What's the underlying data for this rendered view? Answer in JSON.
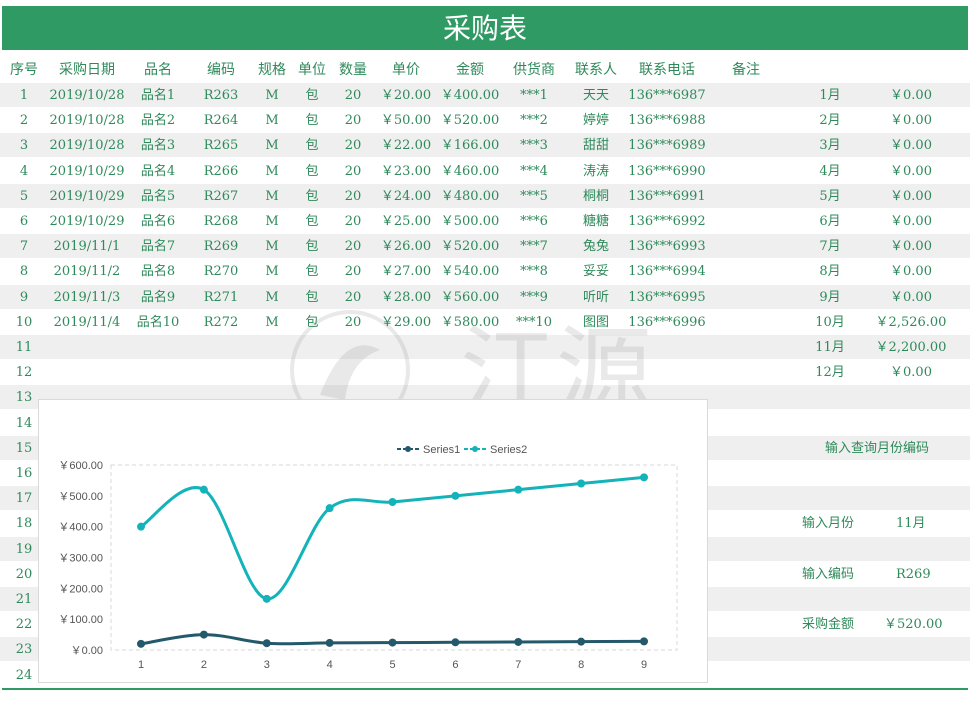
{
  "title": "采购表",
  "headers": [
    "序号",
    "采购日期",
    "品名",
    "编码",
    "规格",
    "单位",
    "数量",
    "单价",
    "金额",
    "供货商",
    "联系人",
    "联系电话",
    "备注"
  ],
  "rows": [
    [
      "1",
      "2019/10/28",
      "品名1",
      "R263",
      "M",
      "包",
      "20",
      "￥20.00",
      "￥400.00",
      "***1",
      "天天",
      "136***6987",
      ""
    ],
    [
      "2",
      "2019/10/28",
      "品名2",
      "R264",
      "M",
      "包",
      "20",
      "￥50.00",
      "￥520.00",
      "***2",
      "婷婷",
      "136***6988",
      ""
    ],
    [
      "3",
      "2019/10/28",
      "品名3",
      "R265",
      "M",
      "包",
      "20",
      "￥22.00",
      "￥166.00",
      "***3",
      "甜甜",
      "136***6989",
      ""
    ],
    [
      "4",
      "2019/10/29",
      "品名4",
      "R266",
      "M",
      "包",
      "20",
      "￥23.00",
      "￥460.00",
      "***4",
      "涛涛",
      "136***6990",
      ""
    ],
    [
      "5",
      "2019/10/29",
      "品名5",
      "R267",
      "M",
      "包",
      "20",
      "￥24.00",
      "￥480.00",
      "***5",
      "桐桐",
      "136***6991",
      ""
    ],
    [
      "6",
      "2019/10/29",
      "品名6",
      "R268",
      "M",
      "包",
      "20",
      "￥25.00",
      "￥500.00",
      "***6",
      "糖糖",
      "136***6992",
      ""
    ],
    [
      "7",
      "2019/11/1",
      "品名7",
      "R269",
      "M",
      "包",
      "20",
      "￥26.00",
      "￥520.00",
      "***7",
      "兔兔",
      "136***6993",
      ""
    ],
    [
      "8",
      "2019/11/2",
      "品名8",
      "R270",
      "M",
      "包",
      "20",
      "￥27.00",
      "￥540.00",
      "***8",
      "妥妥",
      "136***6994",
      ""
    ],
    [
      "9",
      "2019/11/3",
      "品名9",
      "R271",
      "M",
      "包",
      "20",
      "￥28.00",
      "￥560.00",
      "***9",
      "听听",
      "136***6995",
      ""
    ],
    [
      "10",
      "2019/11/4",
      "品名10",
      "R272",
      "M",
      "包",
      "20",
      "￥29.00",
      "￥580.00",
      "***10",
      "图图",
      "136***6996",
      ""
    ]
  ],
  "row_numbers": [
    "11",
    "12",
    "13",
    "14",
    "15",
    "16",
    "17",
    "18",
    "19",
    "20",
    "21",
    "22",
    "23",
    "24"
  ],
  "monthly": [
    [
      "1月",
      "￥0.00"
    ],
    [
      "2月",
      "￥0.00"
    ],
    [
      "3月",
      "￥0.00"
    ],
    [
      "4月",
      "￥0.00"
    ],
    [
      "5月",
      "￥0.00"
    ],
    [
      "6月",
      "￥0.00"
    ],
    [
      "7月",
      "￥0.00"
    ],
    [
      "8月",
      "￥0.00"
    ],
    [
      "9月",
      "￥0.00"
    ],
    [
      "10月",
      "￥2,526.00"
    ],
    [
      "11月",
      "￥2,200.00"
    ],
    [
      "12月",
      "￥0.00"
    ]
  ],
  "lookup": {
    "prompt": "输入查询月份编码",
    "month_label": "输入月份",
    "month_value": "11月",
    "code_label": "输入编码",
    "code_value": "R269",
    "amount_label": "采购金额",
    "amount_value": "￥520.00"
  },
  "watermark_text": "江源",
  "chart_data": {
    "type": "line",
    "x": [
      1,
      2,
      3,
      4,
      5,
      6,
      7,
      8,
      9
    ],
    "series": [
      {
        "name": "Series1",
        "values": [
          20,
          50,
          22,
          23,
          24,
          25,
          26,
          27,
          28
        ],
        "color": "#23596b"
      },
      {
        "name": "Series2",
        "values": [
          400,
          520,
          166,
          460,
          480,
          500,
          520,
          540,
          560
        ],
        "color": "#13b3b9"
      }
    ],
    "ylim": [
      0,
      600
    ],
    "yticks": [
      "￥0.00",
      "￥100.00",
      "￥200.00",
      "￥300.00",
      "￥400.00",
      "￥500.00",
      "￥600.00"
    ],
    "legend": "top-center",
    "grid": false
  }
}
